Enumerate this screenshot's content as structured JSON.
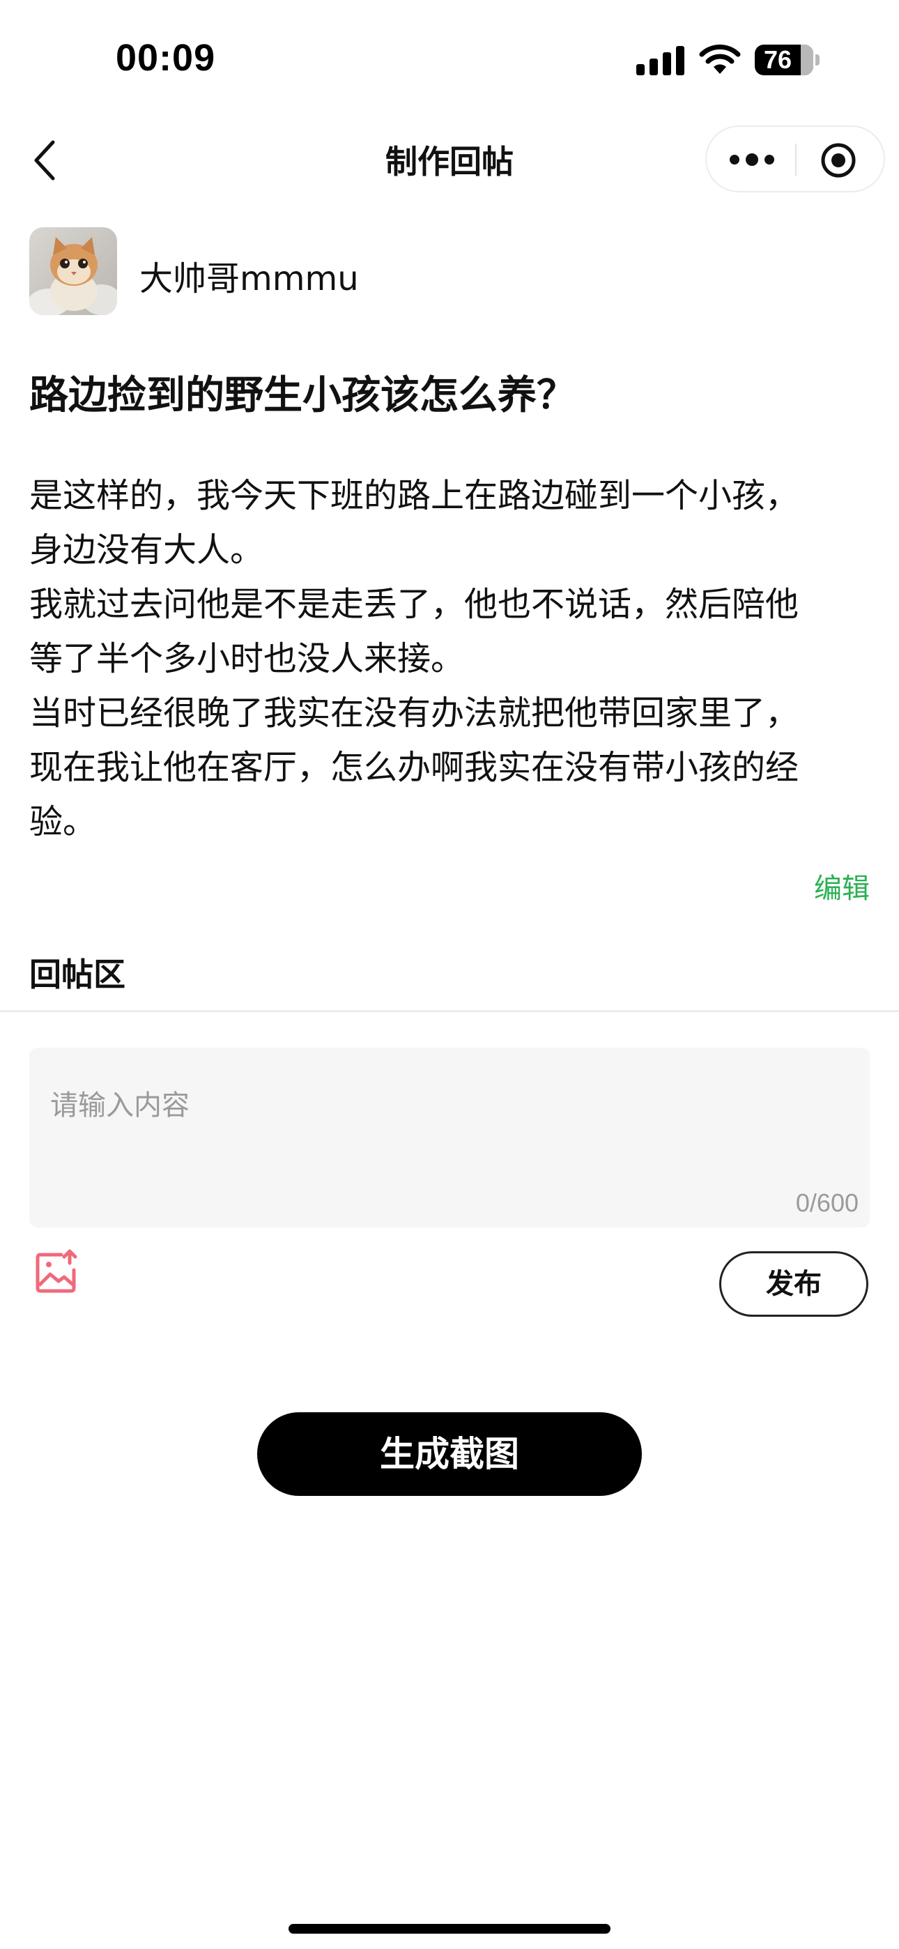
{
  "status_bar": {
    "time": "00:09",
    "battery": "76",
    "icons": [
      "signal-icon",
      "wifi-icon",
      "battery-icon"
    ]
  },
  "nav": {
    "title": "制作回帖",
    "icons": [
      "back-arrow-icon",
      "more-dots-icon",
      "target-circle-icon"
    ]
  },
  "author": {
    "name": "大帅哥mmmu",
    "avatar": "kitten-photo"
  },
  "post": {
    "title": "路边捡到的野生小孩该怎么养？",
    "body_lines": [
      "是这样的，我今天下班的路上在路边碰到一个小孩，",
      "身边没有大人。",
      "我就过去问他是不是走丢了，他也不说话，然后陪他",
      "等了半个多小时也没人来接。",
      "当时已经很晚了我实在没有办法就把他带回家里了，",
      "现在我让他在客厅，怎么办啊我实在没有带小孩的经",
      "验。"
    ],
    "edit_label": "编辑"
  },
  "reply": {
    "section_title": "回帖区",
    "placeholder": "请输入内容",
    "counter": "0/600",
    "image_icon": "image-upload-icon",
    "publish_label": "发布"
  },
  "generate_label": "生成截图",
  "colors": {
    "edit_link": "#2bb053",
    "upload_icon": "#f0697a",
    "primary_button": "#000000",
    "input_bg": "#f6f6f6"
  }
}
